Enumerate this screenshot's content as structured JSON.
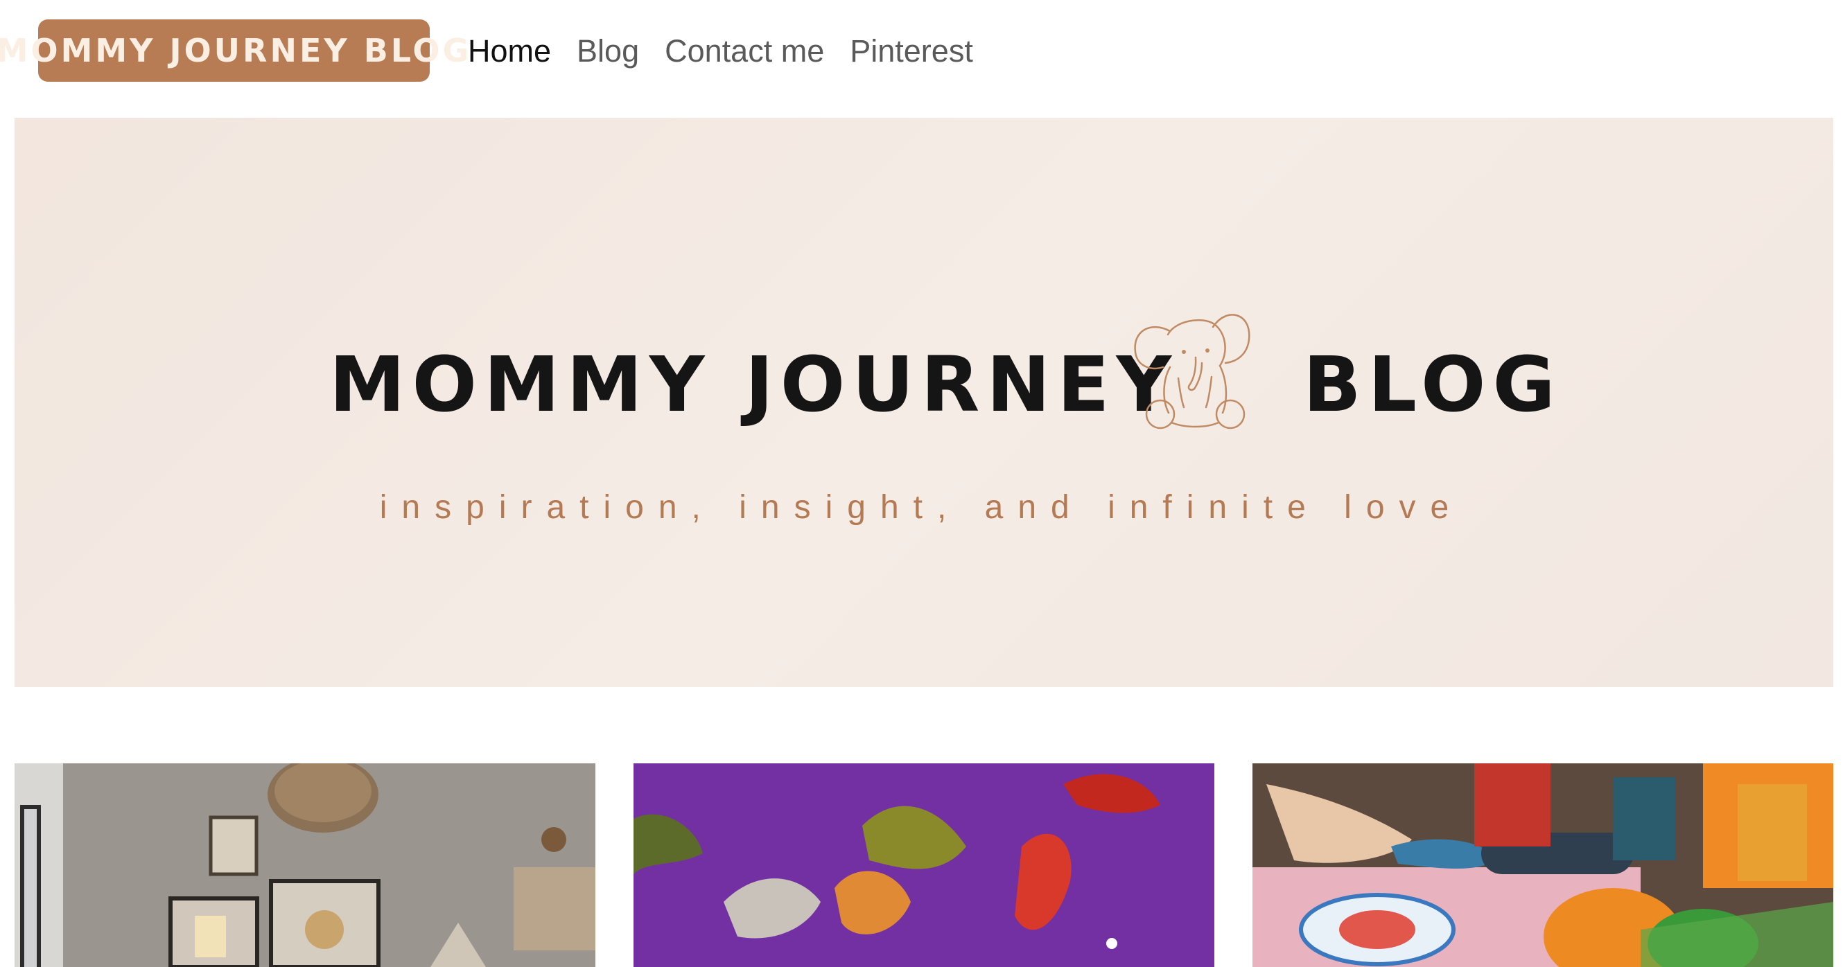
{
  "header": {
    "logo_label": "MOMMY JOURNEY BLOG",
    "nav": [
      {
        "label": "Home",
        "active": true
      },
      {
        "label": "Blog",
        "active": false
      },
      {
        "label": "Contact me",
        "active": false
      },
      {
        "label": "Pinterest",
        "active": false
      }
    ]
  },
  "hero": {
    "title_left": "MOMMY JOURNEY",
    "title_right": "BLOG",
    "tagline": "inspiration, insight, and infinite love",
    "icon": "elephant-icon"
  },
  "cards": [
    {
      "image": "nursery-room-photo"
    },
    {
      "image": "toy-dinosaurs-purple-sand-photo"
    },
    {
      "image": "child-playing-play-dough-photo"
    }
  ],
  "colors": {
    "accent": "#b77c54",
    "hero_bg": "#f3e8e1",
    "tagline": "#b47a54",
    "title": "#151515"
  }
}
